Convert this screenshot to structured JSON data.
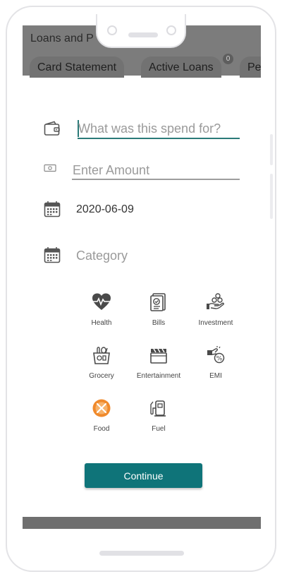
{
  "appbar": {
    "title": "Loans and P",
    "tabs": [
      {
        "label": "Card Statement"
      },
      {
        "label": "Active Loans",
        "badge": "0"
      },
      {
        "label": "Pe"
      }
    ]
  },
  "form": {
    "description": {
      "placeholder": "What was this spend for?",
      "icon": "wallet-icon"
    },
    "amount": {
      "placeholder": "Enter Amount",
      "icon": "cash-icon"
    },
    "date": {
      "value": "2020-06-09",
      "icon": "calendar-icon"
    },
    "category": {
      "placeholder": "Category",
      "icon": "calendar-icon"
    }
  },
  "categories": [
    {
      "label": "Health",
      "icon": "heart-pulse-icon"
    },
    {
      "label": "Bills",
      "icon": "bill-icon"
    },
    {
      "label": "Investment",
      "icon": "investment-icon"
    },
    {
      "label": "Grocery",
      "icon": "grocery-bag-icon"
    },
    {
      "label": "Entertainment",
      "icon": "clapperboard-icon"
    },
    {
      "label": "EMI",
      "icon": "emi-icon"
    },
    {
      "label": "Food",
      "icon": "food-icon"
    },
    {
      "label": "Fuel",
      "icon": "fuel-pump-icon"
    }
  ],
  "continue_label": "Continue",
  "colors": {
    "accent": "#0f7479",
    "overlay": "#7c7c7c",
    "food_icon": "#f08a2c"
  }
}
